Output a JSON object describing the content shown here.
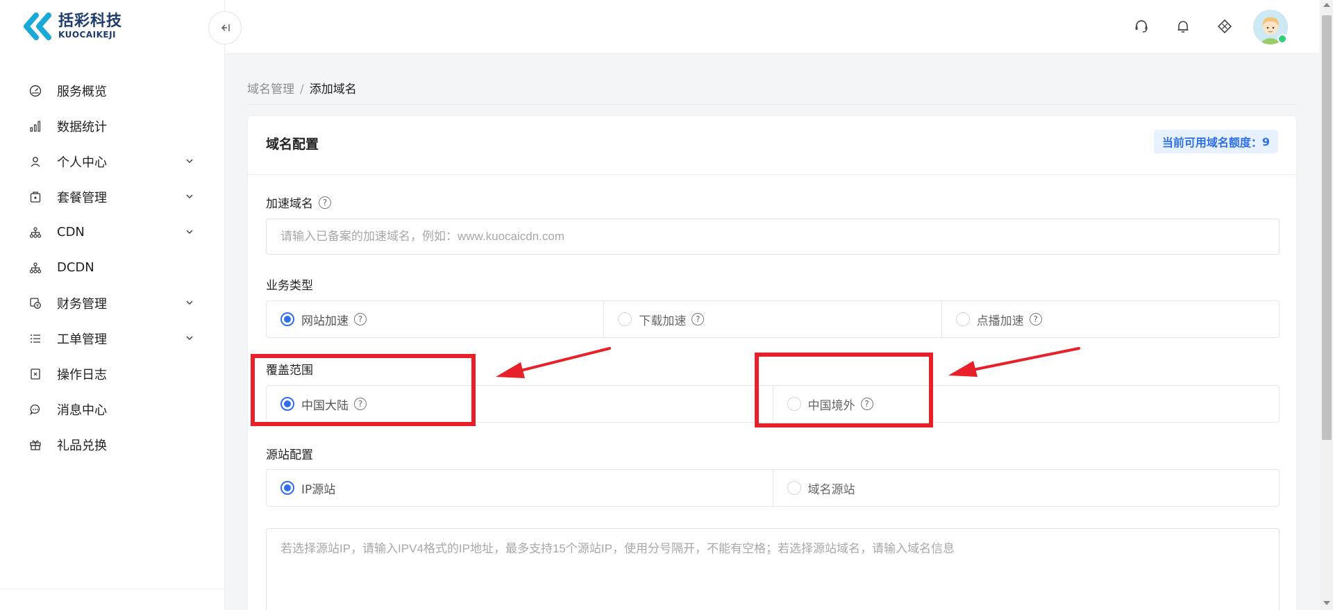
{
  "logo": {
    "cn": "括彩科技",
    "en": "KUOCAIKEJI",
    "brand_color": "#19a8d8"
  },
  "sidebar": {
    "collapse_label": "←|",
    "items": [
      {
        "label": "服务概览",
        "icon": "dashboard-icon",
        "expandable": false
      },
      {
        "label": "数据统计",
        "icon": "bar-chart-icon",
        "expandable": false
      },
      {
        "label": "个人中心",
        "icon": "user-icon",
        "expandable": true
      },
      {
        "label": "套餐管理",
        "icon": "package-icon",
        "expandable": true
      },
      {
        "label": "CDN",
        "icon": "network-icon",
        "expandable": true
      },
      {
        "label": "DCDN",
        "icon": "network-icon",
        "expandable": false
      },
      {
        "label": "财务管理",
        "icon": "finance-icon",
        "expandable": true
      },
      {
        "label": "工单管理",
        "icon": "list-icon",
        "expandable": true
      },
      {
        "label": "操作日志",
        "icon": "log-icon",
        "expandable": false
      },
      {
        "label": "消息中心",
        "icon": "message-icon",
        "expandable": false
      },
      {
        "label": "礼品兑换",
        "icon": "gift-icon",
        "expandable": false
      }
    ]
  },
  "header": {
    "icons": [
      "headset-icon",
      "bell-icon",
      "diamond-icon"
    ],
    "status_color": "#2fcf7e"
  },
  "breadcrumb": {
    "parent": "域名管理",
    "separator": "/",
    "current": "添加域名"
  },
  "card": {
    "title": "域名配置",
    "quota_label": "当前可用域名额度：",
    "quota_value": "9",
    "accent_color": "#2f6fea"
  },
  "form": {
    "domain": {
      "label": "加速域名",
      "value": "",
      "placeholder": "请输入已备案的加速域名，例如：www.kuocaicdn.com"
    },
    "business_type": {
      "label": "业务类型",
      "options": [
        {
          "label": "网站加速",
          "selected": true
        },
        {
          "label": "下载加速",
          "selected": false
        },
        {
          "label": "点播加速",
          "selected": false
        }
      ]
    },
    "coverage": {
      "label": "覆盖范围",
      "options": [
        {
          "label": "中国大陆",
          "selected": true
        },
        {
          "label": "中国境外",
          "selected": false
        }
      ]
    },
    "origin": {
      "label": "源站配置",
      "options": [
        {
          "label": "IP源站",
          "selected": true
        },
        {
          "label": "域名源站",
          "selected": false
        }
      ],
      "value": "",
      "placeholder": "若选择源站IP，请输入IPV4格式的IP地址，最多支持15个源站IP，使用分号隔开，不能有空格；若选择源站域名，请输入域名信息"
    }
  },
  "annotation_color": "#e8202a"
}
